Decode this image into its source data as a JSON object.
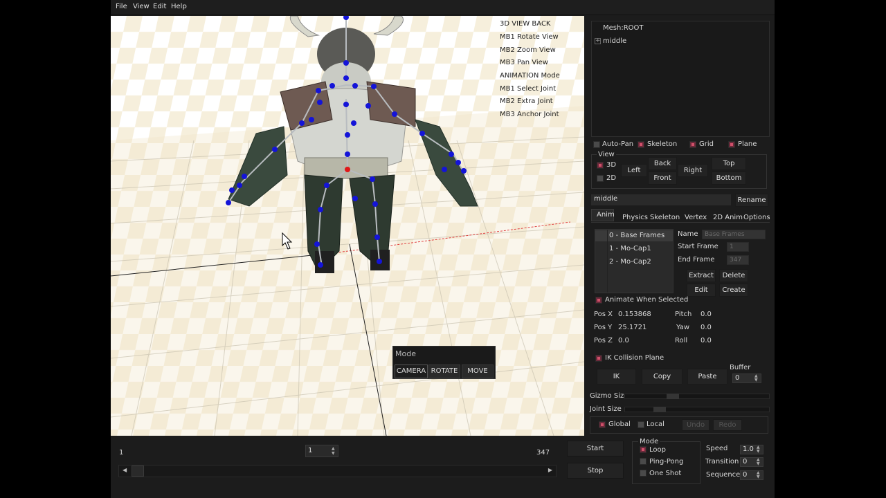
{
  "menu": {
    "file": "File",
    "view": "View",
    "edit": "Edit",
    "help": "Help"
  },
  "viewport_info": [
    "3D VIEW  BACK",
    "MB1 Rotate View",
    "MB2 Zoom View",
    "MB3 Pan View",
    "ANIMATION Mode",
    "MB1 Select Joint",
    "MB2 Extra Joint",
    "MB3 Anchor Joint"
  ],
  "mode_popup": {
    "title": "Mode",
    "camera": "CAMERA",
    "rotate": "ROTATE",
    "move": "MOVE"
  },
  "tree": {
    "root": "Mesh:ROOT",
    "child": "middle",
    "expand": "+"
  },
  "toggles": {
    "auto_pan": "Auto-Pan",
    "skeleton": "Skeleton",
    "grid": "Grid",
    "plane": "Plane"
  },
  "view_group": {
    "label": "View",
    "d3": "3D",
    "d2": "2D",
    "left": "Left",
    "back": "Back",
    "front": "Front",
    "right": "Right",
    "top": "Top",
    "bottom": "Bottom"
  },
  "name_field": {
    "value": "middle",
    "rename": "Rename"
  },
  "tabs": [
    "Anim",
    "Physics",
    "Skeleton",
    "Vertex",
    "2D Anim",
    "Options"
  ],
  "anim_list": [
    "0 - Base Frames",
    "1 - Mo-Cap1",
    "2 - Mo-Cap2"
  ],
  "anim_props": {
    "name_label": "Name",
    "name_value": "Base Frames",
    "start_label": "Start Frame",
    "start_value": "1",
    "end_label": "End Frame",
    "end_value": "347",
    "extract": "Extract",
    "delete": "Delete",
    "edit": "Edit",
    "create": "Create"
  },
  "animate_when_selected": "Animate When Selected",
  "pos": {
    "x_label": "Pos X",
    "x_value": "0.153868",
    "y_label": "Pos Y",
    "y_value": "25.1721",
    "z_label": "Pos Z",
    "z_value": "0.0",
    "pitch_label": "Pitch",
    "pitch_value": "0.0",
    "yaw_label": "Yaw",
    "yaw_value": "0.0",
    "roll_label": "Roll",
    "roll_value": "0.0"
  },
  "ik": {
    "collision": "IK Collision Plane",
    "ik": "IK",
    "copy": "Copy",
    "paste": "Paste",
    "buffer_label": "Buffer",
    "buffer_value": "0"
  },
  "sliders": {
    "gizmo": "Gizmo Size",
    "joint": "Joint Size"
  },
  "coords": {
    "global": "Global",
    "local": "Local",
    "undo": "Undo",
    "redo": "Redo"
  },
  "timeline": {
    "start_frame": "1",
    "current_frame": "1",
    "end_frame": "347"
  },
  "playback": {
    "start": "Start",
    "stop": "Stop"
  },
  "play_mode": {
    "label": "Mode",
    "loop": "Loop",
    "ping_pong": "Ping-Pong",
    "one_shot": "One Shot"
  },
  "speed": {
    "speed_label": "Speed",
    "speed_value": "1.0",
    "transition_label": "Transition",
    "transition_value": "0",
    "sequence_label": "Sequence",
    "sequence_value": "0"
  }
}
